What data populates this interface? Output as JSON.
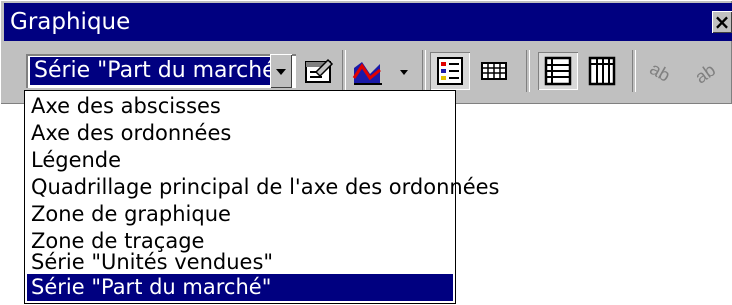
{
  "window": {
    "title": "Graphique"
  },
  "toolbar": {
    "selected_object": "Série \"Part du marché\"",
    "buttons": [
      {
        "name": "format-selection-icon"
      },
      {
        "name": "chart-type-icon",
        "has_dropdown": true
      },
      {
        "name": "legend-icon",
        "pressed": true
      },
      {
        "name": "data-table-icon"
      },
      {
        "name": "by-row-icon",
        "pressed": true
      },
      {
        "name": "by-column-icon"
      },
      {
        "name": "angle-text-downward-icon"
      },
      {
        "name": "angle-text-upward-icon"
      }
    ]
  },
  "dropdown": {
    "items": [
      "Axe des abscisses",
      "Axe des ordonnées",
      "Légende",
      "Quadrillage principal de l'axe des ordonnées",
      "Zone de graphique",
      "Zone de traçage",
      "Série \"Unités vendues\"",
      "Série \"Part du marché\""
    ],
    "selected_index": 7
  },
  "colors": {
    "title_bar": "#000080",
    "selection": "#000080",
    "face": "#c0c0c0"
  }
}
